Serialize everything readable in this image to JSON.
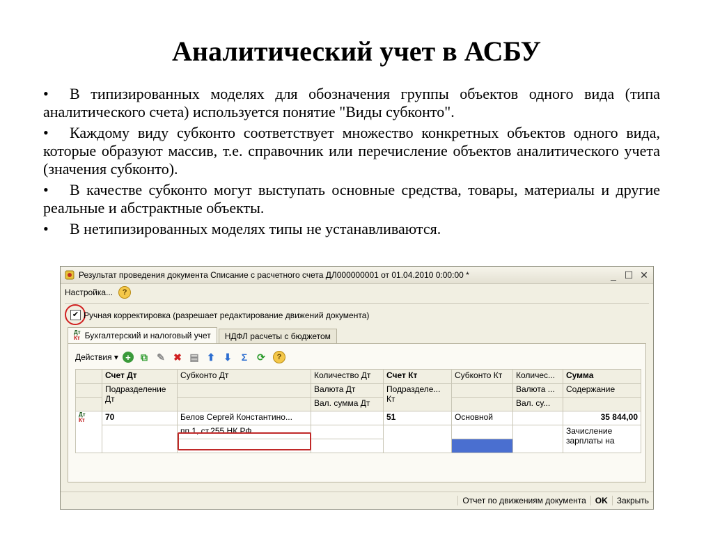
{
  "slide": {
    "title": "Аналитический учет в АСБУ",
    "bullets": [
      "В типизированных моделях для обозначения группы объектов одного вида (типа аналитического счета) используется понятие \"Виды субконто\".",
      "Каждому виду субконто соответствует множество конкретных объектов одного вида, которые образуют массив, т.е. справочник или перечисление объектов аналитического учета (значения субконто).",
      "В качестве субконто могут выступать основные средства, товары, материалы и другие реальные и абстрактные объекты.",
      "В нетипизированных моделях типы не устанавливаются."
    ],
    "bullet_marker": "•"
  },
  "window": {
    "title": "Результат проведения документа Списание с расчетного счета ДЛ000000001 от 01.04.2010 0:00:00 *",
    "menu_settings": "Настройка...",
    "help": "?",
    "manual_label": "Ручная корректировка (разрешает редактирование движений документа)",
    "manual_checked": "✔",
    "tabs": [
      "Бухгалтерский и налоговый учет",
      "НДФЛ расчеты с бюджетом"
    ],
    "dt": "Дт",
    "kt": "Кт",
    "actions": "Действия",
    "grid": {
      "h1": [
        "Счет Дт",
        "Субконто Дт",
        "Количество Дт",
        "Счет Кт",
        "Субконто Кт",
        "Количес...",
        "Сумма"
      ],
      "h2": [
        "Подразделение Дт",
        "",
        "Валюта Дт",
        "Подразделе... Кт",
        "",
        "Валюта ...",
        "Содержание"
      ],
      "h3": [
        "",
        "",
        "Вал. сумма Дт",
        "",
        "",
        "Вал. су...",
        ""
      ],
      "row1": [
        "70",
        "Белов Сергей Константино...",
        "",
        "51",
        "Основной",
        "",
        "35 844,00"
      ],
      "row2": [
        "",
        "пп.1, ст.255 НК РФ",
        "",
        "",
        "",
        "",
        "Зачисление зарплаты на"
      ]
    },
    "status": {
      "report": "Отчет по движениям документа",
      "ok": "OK",
      "close": "Закрыть"
    }
  }
}
